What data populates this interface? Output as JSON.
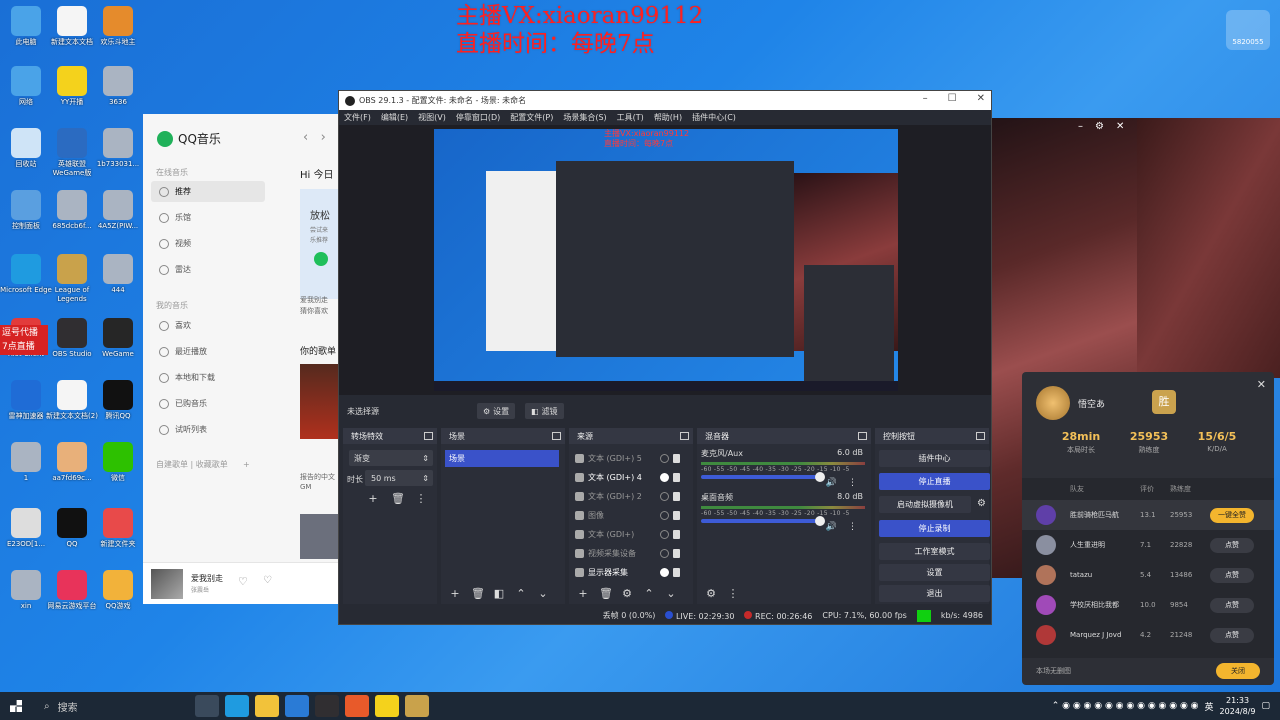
{
  "overlay": {
    "line1": "主播VX:xiaoran99112",
    "line2": "直播时间：每晚7点",
    "badge": "逗号代播\n7点直播",
    "douyu_id": "5820055"
  },
  "desktop_icons": [
    {
      "label": "此电脑",
      "color": "#4aa3e8"
    },
    {
      "label": "新建文本文档",
      "color": "#f5f5f5"
    },
    {
      "label": "欢乐斗地主",
      "color": "#e58b2c"
    },
    {
      "label": "网络",
      "color": "#4aa3e8"
    },
    {
      "label": "YY开播",
      "color": "#f4d21c"
    },
    {
      "label": "3636",
      "color": "#aab4c2"
    },
    {
      "label": "回收站",
      "color": "#cfe4f7"
    },
    {
      "label": "英雄联盟WeGame版",
      "color": "#2b6bc1"
    },
    {
      "label": "1b733031...",
      "color": "#aab4c2"
    },
    {
      "label": "控制面板",
      "color": "#5a9fe0"
    },
    {
      "label": "685dcb6f...",
      "color": "#aab4c2"
    },
    {
      "label": "4A5Z(PIW...",
      "color": "#aab4c2"
    },
    {
      "label": "Microsoft Edge",
      "color": "#1f9be0"
    },
    {
      "label": "League of Legends",
      "color": "#c9a24b"
    },
    {
      "label": "444",
      "color": "#aab4c2"
    },
    {
      "label": "Riot Client",
      "color": "#e23b3b"
    },
    {
      "label": "OBS Studio",
      "color": "#302e31"
    },
    {
      "label": "WeGame",
      "color": "#262626"
    },
    {
      "label": "雷神加速器",
      "color": "#1f6cd6"
    },
    {
      "label": "新建文本文档(2)",
      "color": "#f5f5f5"
    },
    {
      "label": "腾讯QQ",
      "color": "#111111"
    },
    {
      "label": "1",
      "color": "#aab4c2"
    },
    {
      "label": "aa7fd69c...",
      "color": "#e8b07a"
    },
    {
      "label": "微信",
      "color": "#2dc100"
    },
    {
      "label": "E23OD[1...",
      "color": "#dddddd"
    },
    {
      "label": "QQ",
      "color": "#111111"
    },
    {
      "label": "新建文件夹",
      "color": "#e84a4a"
    },
    {
      "label": "xin",
      "color": "#aab4c2"
    },
    {
      "label": "网易云游戏平台",
      "color": "#e8335a"
    },
    {
      "label": "QQ游戏",
      "color": "#f2b23a"
    }
  ],
  "qqmusic": {
    "app_name": "QQ音乐",
    "online_section": "在线音乐",
    "items": [
      "推荐",
      "乐馆",
      "视频",
      "雷达"
    ],
    "my_section": "我的音乐",
    "my_items": [
      "喜欢",
      "最近播放",
      "本地和下载",
      "已购音乐",
      "试听列表"
    ],
    "playlist_tabs": [
      "自建歌单",
      "收藏歌单"
    ],
    "greeting": "Hi 今日",
    "card_title": "放松",
    "card_text1": "尝试来",
    "card_text2": "乐推荐",
    "desc1": "爱我别走",
    "desc2": "猜你喜欢",
    "section": "你的歌单",
    "desc3": "报告的中文",
    "desc4": "GM",
    "now_playing_title": "爱我别走",
    "now_playing_artist": "张震岳"
  },
  "obs": {
    "title": "OBS 29.1.3 - 配置文件: 未命名 - 场景: 未命名",
    "menu": [
      "文件(F)",
      "编辑(E)",
      "视图(V)",
      "停靠窗口(D)",
      "配置文件(P)",
      "场景集合(S)",
      "工具(T)",
      "帮助(H)",
      "插件中心(C)"
    ],
    "no_source": "未选择源",
    "props_btn": "设置",
    "filters_btn": "滤镜",
    "preview_text1": "主播VX:xiaoran99112",
    "preview_text2": "直播时间：每晚7点",
    "docks": {
      "transitions": "转场特效",
      "scenes": "场景",
      "sources": "来源",
      "mixer": "混音器",
      "controls": "控制按钮"
    },
    "transition_value": "渐变",
    "duration_label": "时长",
    "duration_value": "50 ms",
    "scene_items": [
      "场景"
    ],
    "sources": [
      {
        "name": "文本 (GDI+) 5",
        "visible": false
      },
      {
        "name": "文本 (GDI+) 4",
        "visible": true
      },
      {
        "name": "文本 (GDI+) 2",
        "visible": false
      },
      {
        "name": "图像",
        "visible": false
      },
      {
        "name": "文本 (GDI+)",
        "visible": false
      },
      {
        "name": "视频采集设备",
        "visible": false
      },
      {
        "name": "显示器采集",
        "visible": true
      }
    ],
    "mixer": [
      {
        "name": "麦克风/Aux",
        "db": "6.0 dB",
        "level": 0.8
      },
      {
        "name": "桌面音频",
        "db": "8.0 dB",
        "level": 0.8
      }
    ],
    "meter_scale": "-60 -55 -50 -45 -40 -35 -30 -25 -20 -15 -10 -5 0",
    "controls": [
      {
        "label": "插件中心",
        "active": false
      },
      {
        "label": "停止直播",
        "active": true
      },
      {
        "label": "启动虚拟摄像机",
        "active": false
      },
      {
        "label": "停止录制",
        "active": true
      },
      {
        "label": "工作室模式",
        "active": false
      },
      {
        "label": "设置",
        "active": false
      },
      {
        "label": "退出",
        "active": false
      }
    ],
    "status": {
      "dropped": "丢帧 0 (0.0%)",
      "live": "LIVE: 02:29:30",
      "rec": "REC: 00:26:46",
      "cpu": "CPU: 7.1%, 60.00 fps",
      "kbps": "kb/s: 4986"
    }
  },
  "game_stats": {
    "player_name": "悟空あ",
    "result_badge": "胜",
    "stats": [
      {
        "value": "28min",
        "label": "本局时长"
      },
      {
        "value": "25953",
        "label": "熟练度"
      },
      {
        "value": "15/6/5",
        "label": "K/D/A"
      }
    ],
    "headers": {
      "team": "队友",
      "score": "评价",
      "proficiency": "熟练度"
    },
    "players": [
      {
        "name": "胜前骑枪匹马航",
        "score": "13.1",
        "proficiency": "25953",
        "action": "一键全赞",
        "highlight": true,
        "color": "#5f3fa8"
      },
      {
        "name": "人生重进明",
        "score": "7.1",
        "proficiency": "22828",
        "action": "点赞",
        "highlight": false,
        "color": "#8a8fa0"
      },
      {
        "name": "tatazu",
        "score": "5.4",
        "proficiency": "13486",
        "action": "点赞",
        "highlight": false,
        "color": "#b0735a"
      },
      {
        "name": "学校厌相比我都",
        "score": "10.0",
        "proficiency": "9854",
        "action": "点赞",
        "highlight": false,
        "color": "#a04ab8"
      },
      {
        "name": "Marquez J Jovd",
        "score": "4.2",
        "proficiency": "21248",
        "action": "点赞",
        "highlight": false,
        "color": "#b03838"
      }
    ],
    "footer_text": "本场无删图",
    "close_btn": "关闭"
  },
  "taskbar": {
    "search": "搜索",
    "apps": [
      {
        "name": "task-view",
        "color": "#3a4a5c"
      },
      {
        "name": "edge",
        "color": "#1f9be0"
      },
      {
        "name": "explorer",
        "color": "#f2c23a"
      },
      {
        "name": "mail",
        "color": "#2a7bd6"
      },
      {
        "name": "obs",
        "color": "#302e31"
      },
      {
        "name": "riot",
        "color": "#e85a2a"
      },
      {
        "name": "yy",
        "color": "#f4d21c"
      },
      {
        "name": "lol",
        "color": "#c9a24b"
      }
    ],
    "lang": "英",
    "time": "21:33",
    "date": "2024/8/9"
  }
}
